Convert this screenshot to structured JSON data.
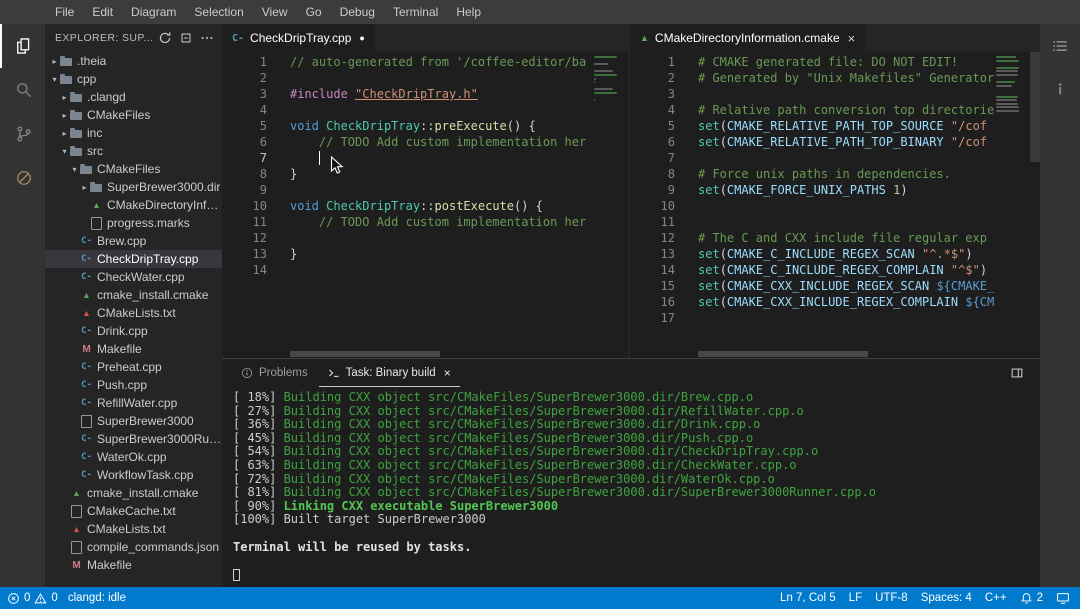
{
  "theme": {
    "statusbar_bg": "#007acc",
    "terminal_green": "#3fa33f",
    "selection_bg": "#37373d",
    "cpp_icon_blue": "#519aba",
    "cmake_icon_green": "#5ea85e",
    "cmake_icon_red": "#d65252"
  },
  "menu": {
    "items": [
      "File",
      "Edit",
      "Diagram",
      "Selection",
      "View",
      "Go",
      "Debug",
      "Terminal",
      "Help"
    ]
  },
  "activity_bar": {
    "items": [
      {
        "icon": "files-icon",
        "active": true
      },
      {
        "icon": "search-icon"
      },
      {
        "icon": "source-control-icon"
      },
      {
        "icon": "circle-slash-icon"
      }
    ]
  },
  "right_bar": {
    "items": [
      {
        "icon": "outline-icon"
      },
      {
        "icon": "info-icon"
      }
    ]
  },
  "explorer": {
    "title": "EXPLORER: SUP...",
    "actions": [
      "refresh-icon",
      "collapse-all-icon",
      "more-icon"
    ],
    "tree": [
      {
        "label": ".theia",
        "type": "folder",
        "depth": 0,
        "chevron": "closed"
      },
      {
        "label": "cpp",
        "type": "folder",
        "depth": 0,
        "chevron": "open"
      },
      {
        "label": ".clangd",
        "type": "folder",
        "depth": 1,
        "chevron": "closed"
      },
      {
        "label": "CMakeFiles",
        "type": "folder",
        "depth": 1,
        "chevron": "closed"
      },
      {
        "label": "inc",
        "type": "folder",
        "depth": 1,
        "chevron": "closed"
      },
      {
        "label": "src",
        "type": "folder",
        "depth": 1,
        "chevron": "open"
      },
      {
        "label": "CMakeFiles",
        "type": "folder",
        "depth": 2,
        "chevron": "open"
      },
      {
        "label": "SuperBrewer3000.dir",
        "type": "folder",
        "depth": 3,
        "chevron": "closed"
      },
      {
        "label": "CMakeDirectoryInfor...",
        "type": "cmake",
        "depth": 3
      },
      {
        "label": "progress.marks",
        "type": "doc",
        "depth": 3
      },
      {
        "label": "Brew.cpp",
        "type": "cpp",
        "depth": 2
      },
      {
        "label": "CheckDripTray.cpp",
        "type": "cpp",
        "depth": 2,
        "selected": true
      },
      {
        "label": "CheckWater.cpp",
        "type": "cpp",
        "depth": 2
      },
      {
        "label": "cmake_install.cmake",
        "type": "cmake",
        "depth": 2
      },
      {
        "label": "CMakeLists.txt",
        "type": "cmakered",
        "depth": 2
      },
      {
        "label": "Drink.cpp",
        "type": "cpp",
        "depth": 2
      },
      {
        "label": "Makefile",
        "type": "make",
        "depth": 2
      },
      {
        "label": "Preheat.cpp",
        "type": "cpp",
        "depth": 2
      },
      {
        "label": "Push.cpp",
        "type": "cpp",
        "depth": 2
      },
      {
        "label": "RefillWater.cpp",
        "type": "cpp",
        "depth": 2
      },
      {
        "label": "SuperBrewer3000",
        "type": "doc",
        "depth": 2
      },
      {
        "label": "SuperBrewer3000Runn...",
        "type": "cpp",
        "depth": 2
      },
      {
        "label": "WaterOk.cpp",
        "type": "cpp",
        "depth": 2
      },
      {
        "label": "WorkflowTask.cpp",
        "type": "cpp",
        "depth": 2
      },
      {
        "label": "cmake_install.cmake",
        "type": "cmake",
        "depth": 1
      },
      {
        "label": "CMakeCache.txt",
        "type": "doc",
        "depth": 1
      },
      {
        "label": "CMakeLists.txt",
        "type": "cmakered",
        "depth": 1
      },
      {
        "label": "compile_commands.json",
        "type": "doc",
        "depth": 1
      },
      {
        "label": "Makefile",
        "type": "make",
        "depth": 1
      }
    ]
  },
  "editors": {
    "left": {
      "tab": {
        "label": "CheckDripTray.cpp",
        "modified": true
      },
      "caret": {
        "line": 7,
        "col": 5
      },
      "lines": [
        [
          [
            "cm",
            "// auto-generated from '/coffee-editor/ba"
          ]
        ],
        [],
        [
          [
            "pp",
            "#include "
          ],
          [
            "stu",
            "\"CheckDripTray.h\""
          ]
        ],
        [],
        [
          [
            "kw",
            "void"
          ],
          [
            "pl",
            " "
          ],
          [
            "ty",
            "CheckDripTray"
          ],
          [
            "pl",
            "::"
          ],
          [
            "fn",
            "preExecute"
          ],
          [
            "pl",
            "() {"
          ]
        ],
        [
          [
            "cm",
            "    // TODO Add custom implementation her"
          ]
        ],
        [
          [
            "pl",
            "    "
          ]
        ],
        [
          [
            "pl",
            "}"
          ]
        ],
        [],
        [
          [
            "kw",
            "void"
          ],
          [
            "pl",
            " "
          ],
          [
            "ty",
            "CheckDripTray"
          ],
          [
            "pl",
            "::"
          ],
          [
            "fn",
            "postExecute"
          ],
          [
            "pl",
            "() {"
          ]
        ],
        [
          [
            "cm",
            "    // TODO Add custom implementation her"
          ]
        ],
        [],
        [
          [
            "pl",
            "}"
          ]
        ],
        []
      ]
    },
    "right": {
      "tab": {
        "label": "CMakeDirectoryInformation.cmake"
      },
      "lines": [
        [
          [
            "cm",
            "# CMAKE generated file: DO NOT EDIT!"
          ]
        ],
        [
          [
            "cm",
            "# Generated by \"Unix Makefiles\" Generator"
          ]
        ],
        [],
        [
          [
            "cm",
            "# Relative path conversion top directorie"
          ]
        ],
        [
          [
            "fc",
            "set"
          ],
          [
            "pl",
            "("
          ],
          [
            "va",
            "CMAKE_RELATIVE_PATH_TOP_SOURCE"
          ],
          [
            "pl",
            " "
          ],
          [
            "st",
            "\"/cof"
          ]
        ],
        [
          [
            "fc",
            "set"
          ],
          [
            "pl",
            "("
          ],
          [
            "va",
            "CMAKE_RELATIVE_PATH_TOP_BINARY"
          ],
          [
            "pl",
            " "
          ],
          [
            "st",
            "\"/cof"
          ]
        ],
        [],
        [
          [
            "cm",
            "# Force unix paths in dependencies."
          ]
        ],
        [
          [
            "fc",
            "set"
          ],
          [
            "pl",
            "("
          ],
          [
            "va",
            "CMAKE_FORCE_UNIX_PATHS"
          ],
          [
            "pl",
            " "
          ],
          [
            "nu",
            "1"
          ],
          [
            "pl",
            ")"
          ]
        ],
        [],
        [],
        [
          [
            "cm",
            "# The C and CXX include file regular exp"
          ]
        ],
        [
          [
            "fc",
            "set"
          ],
          [
            "pl",
            "("
          ],
          [
            "va",
            "CMAKE_C_INCLUDE_REGEX_SCAN"
          ],
          [
            "pl",
            " "
          ],
          [
            "st",
            "\"^.*$\""
          ],
          [
            "pl",
            ")"
          ]
        ],
        [
          [
            "fc",
            "set"
          ],
          [
            "pl",
            "("
          ],
          [
            "va",
            "CMAKE_C_INCLUDE_REGEX_COMPLAIN"
          ],
          [
            "pl",
            " "
          ],
          [
            "st",
            "\"^$\""
          ],
          [
            "pl",
            ")"
          ]
        ],
        [
          [
            "fc",
            "set"
          ],
          [
            "pl",
            "("
          ],
          [
            "va",
            "CMAKE_CXX_INCLUDE_REGEX_SCAN"
          ],
          [
            "pl",
            " "
          ],
          [
            "ip",
            "${CMAKE_"
          ]
        ],
        [
          [
            "fc",
            "set"
          ],
          [
            "pl",
            "("
          ],
          [
            "va",
            "CMAKE_CXX_INCLUDE_REGEX_COMPLAIN"
          ],
          [
            "pl",
            " "
          ],
          [
            "ip",
            "${CM"
          ]
        ],
        []
      ]
    }
  },
  "panel": {
    "tabs": [
      {
        "label": "Problems",
        "icon": "info"
      },
      {
        "label": "Task: Binary build",
        "icon": "terminal",
        "active": true,
        "closable": true
      }
    ],
    "terminal": [
      [
        [
          "tp",
          "[ 18%] "
        ],
        [
          "tg",
          "Building CXX object src/CMakeFiles/SuperBrewer3000.dir/Brew.cpp.o"
        ]
      ],
      [
        [
          "tp",
          "[ 27%] "
        ],
        [
          "tg",
          "Building CXX object src/CMakeFiles/SuperBrewer3000.dir/RefillWater.cpp.o"
        ]
      ],
      [
        [
          "tp",
          "[ 36%] "
        ],
        [
          "tg",
          "Building CXX object src/CMakeFiles/SuperBrewer3000.dir/Drink.cpp.o"
        ]
      ],
      [
        [
          "tp",
          "[ 45%] "
        ],
        [
          "tg",
          "Building CXX object src/CMakeFiles/SuperBrewer3000.dir/Push.cpp.o"
        ]
      ],
      [
        [
          "tp",
          "[ 54%] "
        ],
        [
          "tg",
          "Building CXX object src/CMakeFiles/SuperBrewer3000.dir/CheckDripTray.cpp.o"
        ]
      ],
      [
        [
          "tp",
          "[ 63%] "
        ],
        [
          "tg",
          "Building CXX object src/CMakeFiles/SuperBrewer3000.dir/CheckWater.cpp.o"
        ]
      ],
      [
        [
          "tp",
          "[ 72%] "
        ],
        [
          "tg",
          "Building CXX object src/CMakeFiles/SuperBrewer3000.dir/WaterOk.cpp.o"
        ]
      ],
      [
        [
          "tp",
          "[ 81%] "
        ],
        [
          "tg",
          "Building CXX object src/CMakeFiles/SuperBrewer3000.dir/SuperBrewer3000Runner.cpp.o"
        ]
      ],
      [
        [
          "tp",
          "[ 90%] "
        ],
        [
          "tgb",
          "Linking CXX executable SuperBrewer3000"
        ]
      ],
      [
        [
          "tp",
          "[100%] Built target SuperBrewer3000"
        ]
      ],
      [],
      [
        [
          "tpb",
          "Terminal will be reused by tasks."
        ]
      ],
      [],
      [
        [
          "cursor",
          ""
        ]
      ]
    ]
  },
  "status_bar": {
    "errors": "0",
    "warnings": "0",
    "clangd": "clangd: idle",
    "right": [
      "Ln 7, Col 5",
      "LF",
      "UTF-8",
      "Spaces: 4",
      "C++"
    ],
    "notifications": "2"
  }
}
